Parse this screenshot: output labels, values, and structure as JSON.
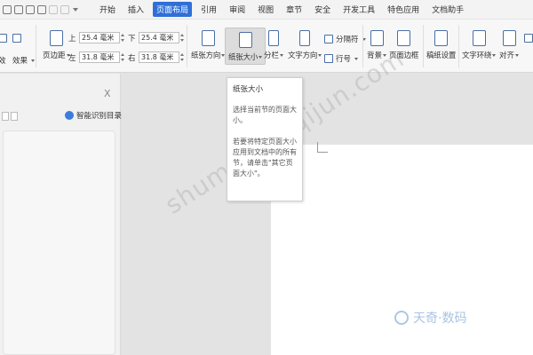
{
  "menubar": {
    "tabs": [
      {
        "label": "开始",
        "active": false
      },
      {
        "label": "插入",
        "active": false
      },
      {
        "label": "页面布局",
        "active": true
      },
      {
        "label": "引用",
        "active": false
      },
      {
        "label": "审阅",
        "active": false
      },
      {
        "label": "视图",
        "active": false
      },
      {
        "label": "章节",
        "active": false
      },
      {
        "label": "安全",
        "active": false
      },
      {
        "label": "开发工具",
        "active": false
      },
      {
        "label": "特色应用",
        "active": false
      },
      {
        "label": "文档助手",
        "active": false
      }
    ]
  },
  "ribbon": {
    "effects_label": "效果",
    "margins_label": "页边距",
    "margins": {
      "top_label": "上",
      "top_value": "25.4 毫米",
      "bottom_label": "下",
      "bottom_value": "25.4 毫米",
      "left_label": "左",
      "left_value": "31.8 毫米",
      "right_label": "右",
      "right_value": "31.8 毫米"
    },
    "orientation_label": "纸张方向",
    "paper_size_label": "纸张大小",
    "columns_label": "分栏",
    "text_direction_label": "文字方向",
    "breaks_label": "分隔符",
    "line_numbers_label": "行号",
    "background_label": "背景",
    "page_border_label": "页面边框",
    "manuscript_label": "稿纸设置",
    "text_wrap_label": "文字环绕",
    "align_label": "对齐"
  },
  "navpanel": {
    "close": "X",
    "smart_toc_label": "智能识别目录"
  },
  "tooltip": {
    "title": "纸张大小",
    "description": "选择当前节的页面大小。",
    "extra": "若要将特定页面大小应用到文档中的所有节，请单击\"其它页面大小\"。"
  },
  "watermark": {
    "text": "shuma.tianqijun.com",
    "brand": "天奇·数码"
  },
  "colors": {
    "accent": "#2f6fd6",
    "ribbon_bg": "#f7f7f7",
    "icon_stroke": "#4a6fa5"
  }
}
